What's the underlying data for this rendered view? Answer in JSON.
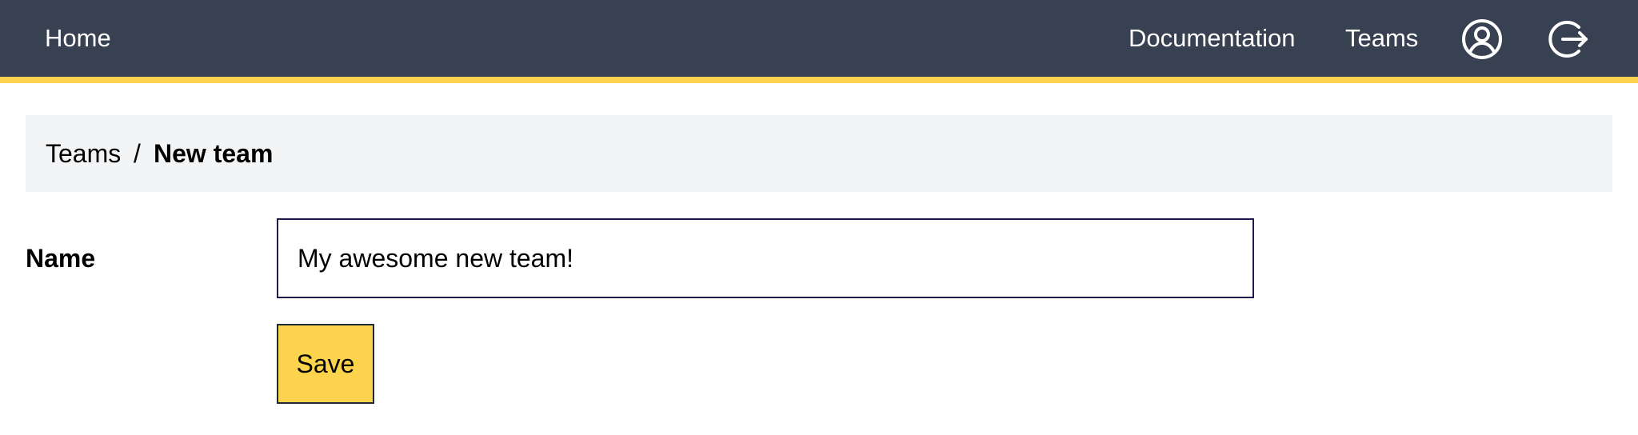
{
  "nav": {
    "home_label": "Home",
    "documentation_label": "Documentation",
    "teams_label": "Teams",
    "profile_icon": "user-circle-icon",
    "logout_icon": "logout-icon"
  },
  "breadcrumb": {
    "parent_label": "Teams",
    "separator": "/",
    "current_label": "New team"
  },
  "form": {
    "name_label": "Name",
    "name_value": "My awesome new team!",
    "save_label": "Save"
  },
  "colors": {
    "topbar_background": "#374151",
    "accent": "#fcd34d",
    "breadcrumb_background": "#f3f4f6"
  }
}
